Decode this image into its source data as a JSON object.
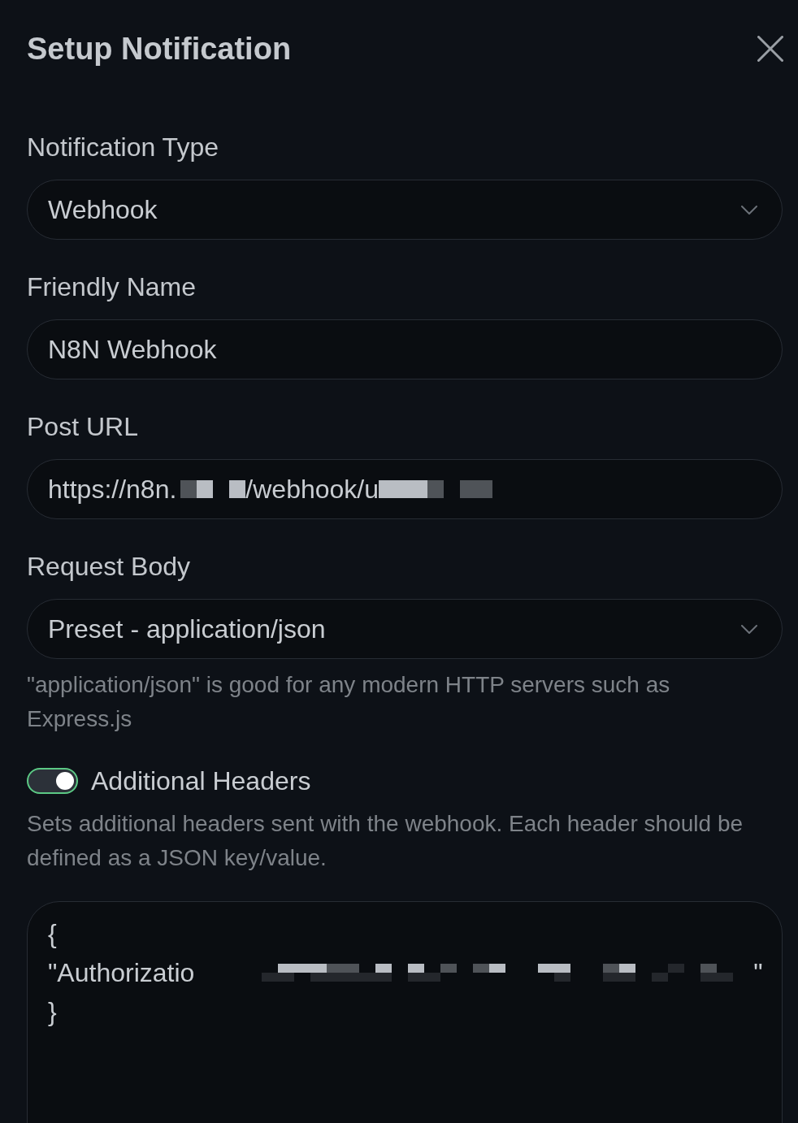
{
  "dialog": {
    "title": "Setup Notification"
  },
  "fields": [
    {
      "kind": "select",
      "label": "Notification Type",
      "value": "Webhook"
    },
    {
      "kind": "input",
      "label": "Friendly Name",
      "value": "N8N Webhook"
    },
    {
      "kind": "input",
      "label": "Post URL",
      "value_parts": [
        {
          "kind": "text",
          "text": "https://n8n."
        },
        {
          "kind": "redacted"
        },
        {
          "kind": "text",
          "text": "/webhook/u"
        },
        {
          "kind": "redacted"
        }
      ]
    },
    {
      "kind": "select",
      "label": "Request Body",
      "value": "Preset - application/json",
      "hint": "\"application/json\" is good for any modern HTTP servers such as Express.js"
    },
    {
      "kind": "switch",
      "label": "Additional Headers",
      "on": true,
      "hint": "Sets additional headers sent with the webhook. Each header should be defined as a JSON key/value."
    },
    {
      "kind": "code",
      "lines": [
        {
          "parts": [
            {
              "kind": "text",
              "text": "{"
            }
          ]
        },
        {
          "parts": [
            {
              "kind": "text",
              "text": "\"Authorizatio"
            },
            {
              "kind": "redacted"
            },
            {
              "kind": "text",
              "text": "\""
            }
          ]
        },
        {
          "parts": [
            {
              "kind": "text",
              "text": "}"
            }
          ]
        }
      ]
    }
  ]
}
